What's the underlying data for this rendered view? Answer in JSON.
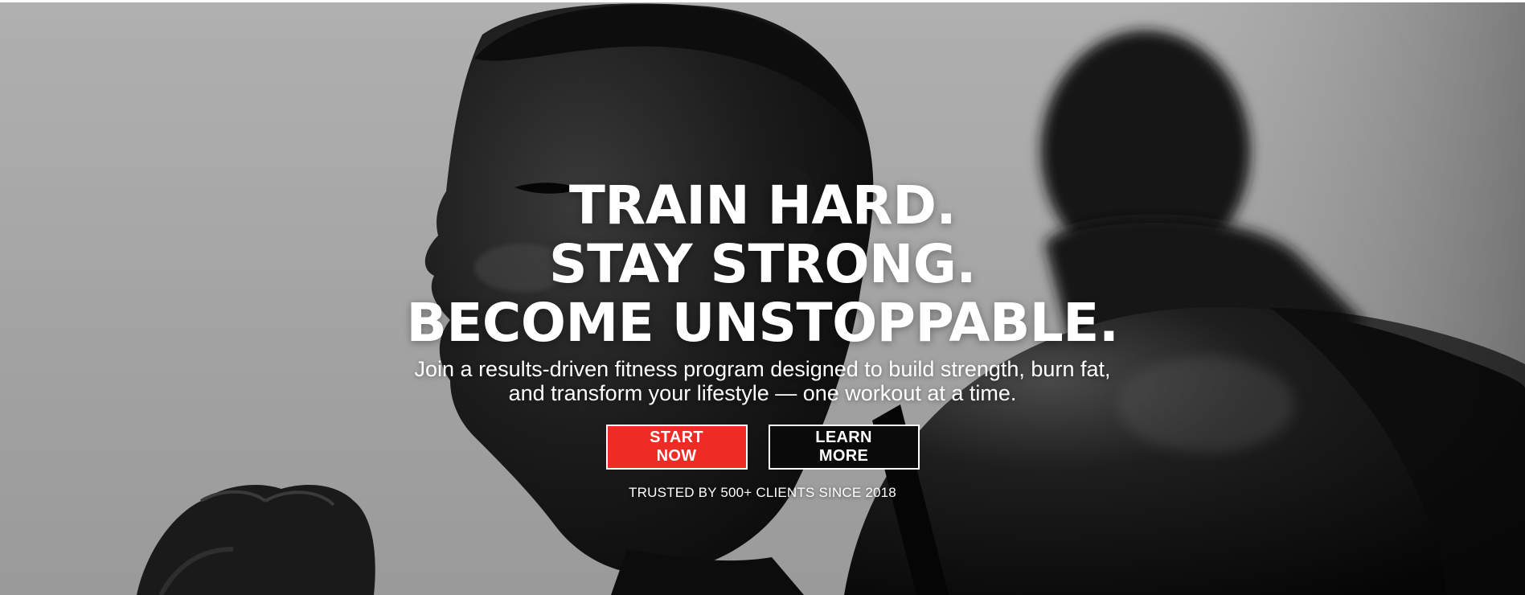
{
  "hero": {
    "headline_line1": "TRAIN HARD.",
    "headline_line2": "STAY STRONG.",
    "headline_line3": "BECOME UNSTOPPABLE.",
    "subtitle": "Join a results-driven fitness program designed to build strength, burn fat, and transform your lifestyle — one workout at a time.",
    "primary_cta": "START NOW",
    "secondary_cta": "LEARN MORE",
    "trust_line": "TRUSTED BY 500+ CLIENTS SINCE 2018"
  },
  "colors": {
    "accent": "#EE2B24",
    "text": "#FFFFFF",
    "secondary_button_bg": "#0A0A0A"
  }
}
